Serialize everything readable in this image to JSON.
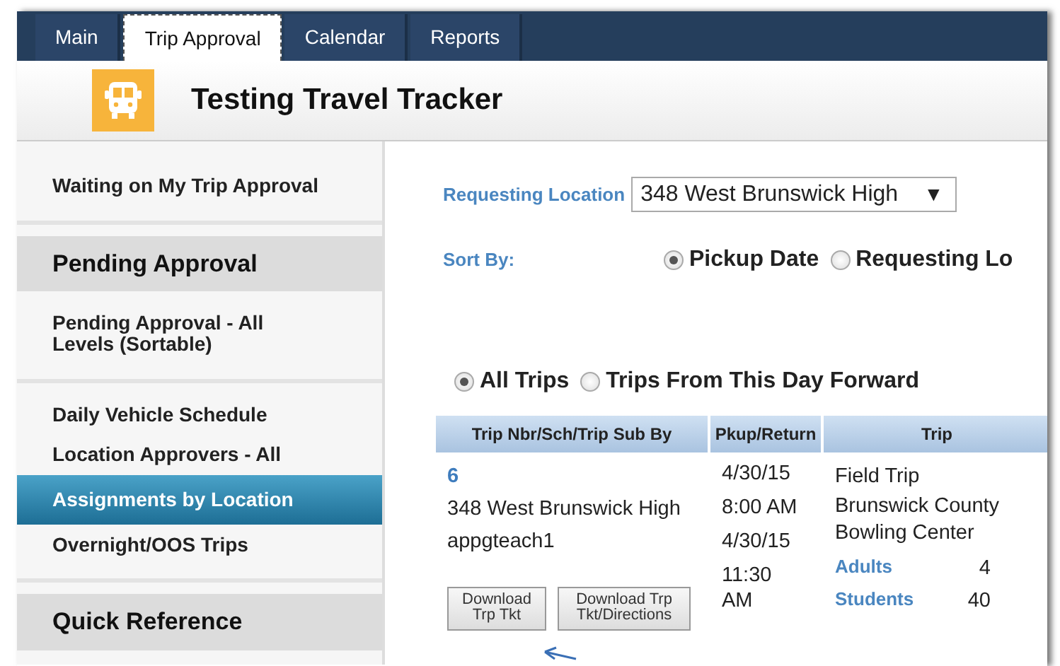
{
  "tabs": [
    {
      "label": "Main",
      "selected": false
    },
    {
      "label": "Trip Approval",
      "selected": true
    },
    {
      "label": "Calendar",
      "selected": false
    },
    {
      "label": "Reports",
      "selected": false
    }
  ],
  "header": {
    "title": "Testing Travel Tracker"
  },
  "sidebar": {
    "sections": [
      {
        "items": [
          {
            "label": "Waiting on My Trip Approval",
            "selected": false
          }
        ]
      },
      {
        "heading": "Pending Approval",
        "items": [
          {
            "label": "Pending Approval - All Levels (Sortable)",
            "selected": false
          }
        ]
      },
      {
        "items": [
          {
            "label": "Daily Vehicle Schedule",
            "selected": false
          },
          {
            "label": "Location Approvers - All",
            "selected": false
          },
          {
            "label": "Assignments by Location",
            "selected": true
          },
          {
            "label": "Overnight/OOS Trips",
            "selected": false
          }
        ]
      },
      {
        "heading": "Quick Reference"
      }
    ]
  },
  "form": {
    "location_label": "Requesting Location",
    "location_value": "348 West Brunswick High",
    "dropdown_arrow": "▼",
    "sort_label": "Sort By:",
    "sort_options": [
      {
        "label": "Pickup Date",
        "selected": true
      },
      {
        "label": "Requesting Lo",
        "selected": false
      }
    ],
    "trip_filter": [
      {
        "label": "All Trips",
        "selected": true
      },
      {
        "label": "Trips From This Day Forward",
        "selected": false
      }
    ]
  },
  "table": {
    "columns": [
      "Trip Nbr/Sch/Trip Sub By",
      "Pkup/Return",
      "Trip"
    ],
    "rows": [
      {
        "trip_number": "6",
        "school": "348 West Brunswick High",
        "submitted_by": "appgteach1",
        "buttons": [
          "Download Trp Tkt",
          "Download Trp Tkt/Directions"
        ],
        "pkup_return": [
          "4/30/15",
          "8:00 AM",
          "4/30/15",
          "11:30 AM"
        ],
        "trip_type": "Field Trip",
        "destination": "Brunswick County Bowling Center",
        "counts": [
          {
            "label": "Adults",
            "value": "4"
          },
          {
            "label": "Students",
            "value": "40"
          }
        ]
      }
    ]
  }
}
